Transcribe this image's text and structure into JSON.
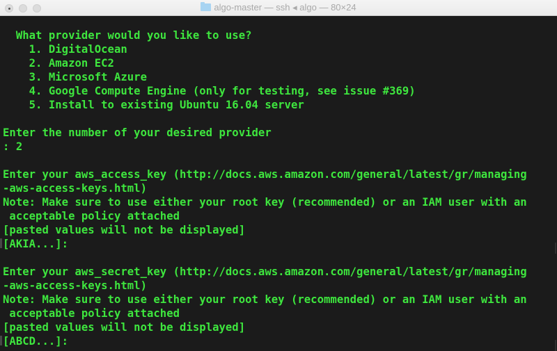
{
  "window": {
    "title": "algo-master — ssh ◂ algo — 80×24",
    "colors": {
      "text": "#3ee63e",
      "background": "#1b1b1b",
      "titlebar": "#ececec"
    }
  },
  "terminal": {
    "lines": [
      "  What provider would you like to use?",
      "    1. DigitalOcean",
      "    2. Amazon EC2",
      "    3. Microsoft Azure",
      "    4. Google Compute Engine (only for testing, see issue #369)",
      "    5. Install to existing Ubuntu 16.04 server",
      "",
      "Enter the number of your desired provider",
      ": 2",
      "",
      "Enter your aws_access_key (http://docs.aws.amazon.com/general/latest/gr/managing",
      "-aws-access-keys.html)",
      "Note: Make sure to use either your root key (recommended) or an IAM user with an",
      " acceptable policy attached",
      "[pasted values will not be displayed]",
      "[AKIA...]:",
      "",
      "Enter your aws_secret_key (http://docs.aws.amazon.com/general/latest/gr/managing",
      "-aws-access-keys.html)",
      "Note: Make sure to use either your root key (recommended) or an IAM user with an",
      " acceptable policy attached",
      "[pasted values will not be displayed]",
      "[ABCD...]:"
    ]
  }
}
